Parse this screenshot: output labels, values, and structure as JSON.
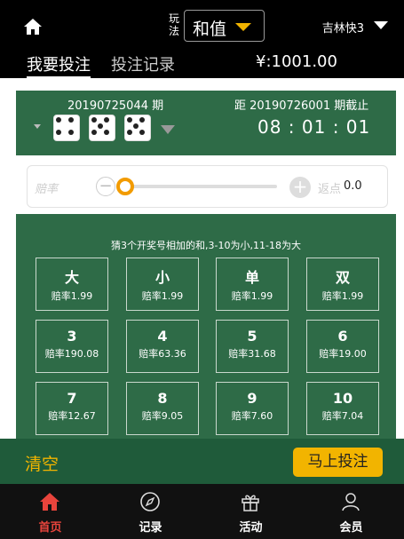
{
  "header": {
    "play_label": "玩法",
    "play_value": "和值",
    "lottery_name": "吉林快3"
  },
  "tabs": {
    "bet": "我要投注",
    "records": "投注记录",
    "balance": "¥:1001.00"
  },
  "draw": {
    "prev_issue": "20190725044 期",
    "next_issue": "距 20190726001 期截止",
    "countdown": "08 : 01 : 01",
    "dice_values": [
      4,
      5,
      5
    ]
  },
  "odds": {
    "label": "赔率",
    "minus": "−",
    "plus": "+",
    "rebate_label": "返点",
    "rebate_value": "0.0",
    "slider_fraction": 0.0
  },
  "bet": {
    "hint": "猜3个开奖号相加的和,3-10为小,11-18为大",
    "cells": [
      {
        "label": "大",
        "odds": "赔率1.99"
      },
      {
        "label": "小",
        "odds": "赔率1.99"
      },
      {
        "label": "单",
        "odds": "赔率1.99"
      },
      {
        "label": "双",
        "odds": "赔率1.99"
      },
      {
        "label": "3",
        "odds": "赔率190.08"
      },
      {
        "label": "4",
        "odds": "赔率63.36"
      },
      {
        "label": "5",
        "odds": "赔率31.68"
      },
      {
        "label": "6",
        "odds": "赔率19.00"
      },
      {
        "label": "7",
        "odds": "赔率12.67"
      },
      {
        "label": "8",
        "odds": "赔率9.05"
      },
      {
        "label": "9",
        "odds": "赔率7.60"
      },
      {
        "label": "10",
        "odds": "赔率7.04"
      }
    ]
  },
  "actions": {
    "clear": "清空",
    "submit": "马上投注"
  },
  "nav": {
    "items": [
      {
        "label": "首页",
        "icon": "home-icon"
      },
      {
        "label": "记录",
        "icon": "compass-icon"
      },
      {
        "label": "活动",
        "icon": "gift-icon"
      },
      {
        "label": "会员",
        "icon": "user-icon"
      }
    ]
  },
  "colors": {
    "green_panel": "#2e6b47",
    "accent_yellow": "#f2b400",
    "active_red": "#e8443c"
  }
}
